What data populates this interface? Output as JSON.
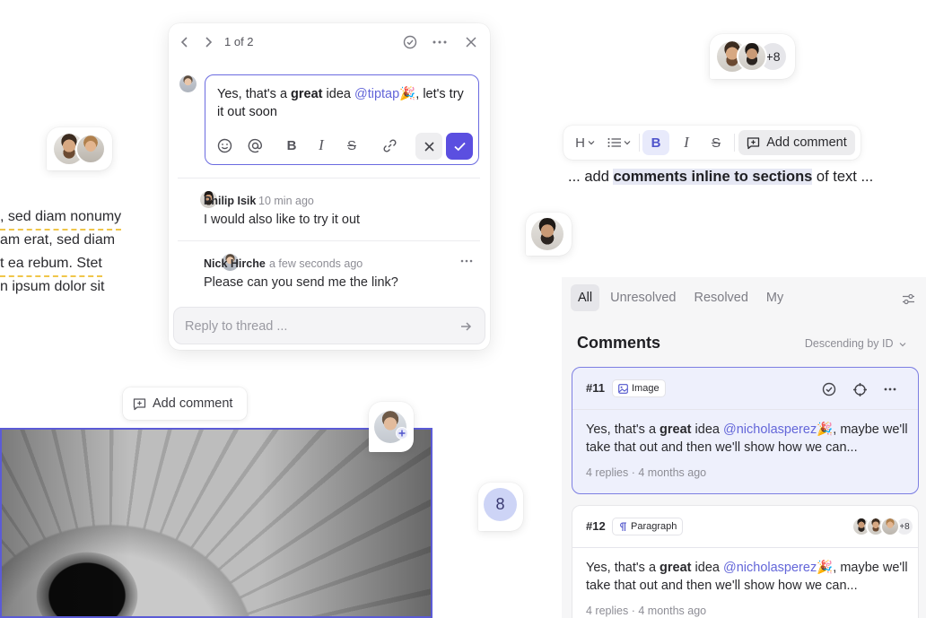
{
  "left_text": {
    "line1": ", sed diam nonumy",
    "line2": "am erat, sed diam",
    "line3": "t ea rebum. Stet",
    "line4": "n ipsum dolor sit"
  },
  "thread": {
    "pager": "1 of 2",
    "editor": {
      "before_bold": "Yes, that's a ",
      "bold": "great",
      "after_bold": " idea ",
      "mention": "@tiptap",
      "emoji": "🎉",
      "after_emoji": ",  let's try it out soon"
    },
    "comments": [
      {
        "name": "Philip Isik",
        "time": "10 min ago",
        "body": "I would also like to try it out"
      },
      {
        "name": "Nick Hirche",
        "time": "a few seconds ago",
        "body": "Please can you send me the link?"
      }
    ],
    "reply_placeholder": "Reply to thread ..."
  },
  "add_comment_chip": "Add comment",
  "toolbar": {
    "heading": "H",
    "add_comment": "Add comment"
  },
  "inline_sentence": {
    "before": "... add ",
    "highlight": "comments inline to sections",
    "after": " of text ..."
  },
  "top_right_stack": {
    "count": "+8"
  },
  "count_bubble": "8",
  "panel": {
    "tabs": [
      "All",
      "Unresolved",
      "Resolved",
      "My"
    ],
    "active_tab": "All",
    "title": "Comments",
    "sort": "Descending by ID",
    "cards": [
      {
        "id": "#11",
        "type": "Image",
        "before_bold": "Yes, that's a ",
        "bold": "great",
        "after_bold": " idea ",
        "mention": "@nicholasperez",
        "emoji": "🎉",
        "after_emoji": ",  maybe we'll take that out and then we'll show how we can...",
        "replies": "4 replies",
        "time": "4 months ago"
      },
      {
        "id": "#12",
        "type": "Paragraph",
        "participants_more": "+8",
        "before_bold": "Yes, that's a ",
        "bold": "great",
        "after_bold": " idea ",
        "mention": "@nicholasperez",
        "emoji": "🎉",
        "after_emoji": ",  maybe we'll take that out and then we'll show how we can...",
        "replies": "4 replies",
        "time": "4 months ago"
      }
    ]
  },
  "colors": {
    "accent": "#5b4fe0",
    "selection_border": "#5b5bd6",
    "mention": "#6366d9",
    "dashed_underline": "#f0c64a",
    "active_card_bg": "#eef0fc"
  }
}
